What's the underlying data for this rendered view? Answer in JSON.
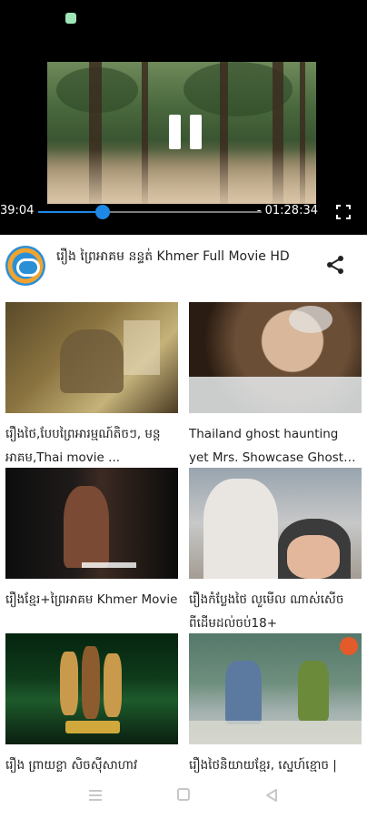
{
  "player": {
    "time_elapsed": "39:04",
    "time_total": "- 01:28:34",
    "progress": 0.29,
    "accent": "#1e88e5"
  },
  "header": {
    "title": "រឿង ព្រៃអាគម នន្ទត់ Khmer Full Movie HD",
    "logo_icon": "channel-logo",
    "share_icon": "share-icon"
  },
  "videos": [
    {
      "title": "រឿងថៃ,បែបព្រៃអារម្មណ៍តិចៗ, មន្តអាគម,Thai movie ..."
    },
    {
      "title": "Thailand ghost haunting yet Mrs. Showcase Ghost Cla..."
    },
    {
      "title": "រឿងខ្មែរ+ព្រៃអាគម Khmer Movie"
    },
    {
      "title": "រឿងកំប្លែងថៃ លួមើល ណាស់សើចពីដើមដល់ចប់18+"
    },
    {
      "title": "រឿង ព្រាយខ្លា សិចស៊ីសាហាវ"
    },
    {
      "title": "រឿងថៃនិយាយខ្មែរ, ស្នេហ៍ខ្មោច |"
    }
  ],
  "navbar": {
    "menu_icon": "menu-icon",
    "home_icon": "home-icon",
    "back_icon": "back-icon"
  }
}
